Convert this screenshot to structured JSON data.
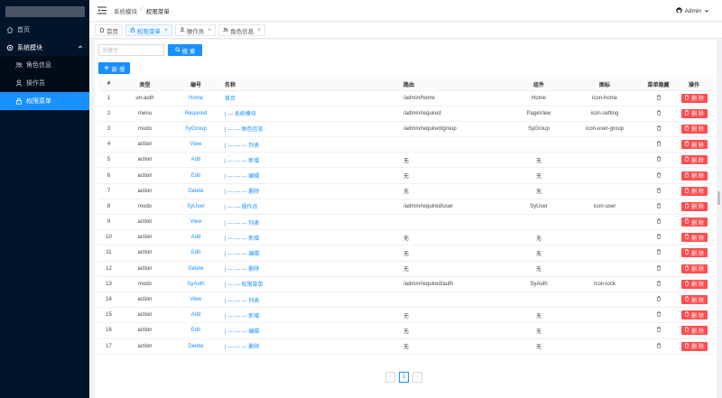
{
  "sidebar": {
    "items": [
      {
        "label": "首页",
        "icon": "home-icon"
      },
      {
        "label": "系统模块",
        "icon": "gear-icon"
      },
      {
        "label": "角色信息",
        "icon": "team-icon"
      },
      {
        "label": "操作员",
        "icon": "user-icon"
      },
      {
        "label": "权限菜单",
        "icon": "lock-icon"
      }
    ]
  },
  "header": {
    "breadcrumb": [
      "系统模块",
      "权限菜单"
    ],
    "separator": "/",
    "user": "Admin"
  },
  "tabs": [
    {
      "label": "首页",
      "icon": "home-icon",
      "closable": false
    },
    {
      "label": "权限菜单",
      "icon": "lock-icon",
      "closable": true
    },
    {
      "label": "操作员",
      "icon": "user-icon",
      "closable": true
    },
    {
      "label": "角色信息",
      "icon": "team-icon",
      "closable": true
    }
  ],
  "tab_close": "×",
  "search": {
    "placeholder": "关键字",
    "button": "搜 索"
  },
  "add_button": "新 增",
  "table": {
    "columns": [
      "#",
      "类型",
      "编号",
      "名称",
      "路由",
      "组件",
      "图标",
      "菜单隐藏",
      "操作"
    ],
    "delete_label": "删 除",
    "rows": [
      {
        "n": "1",
        "type": "un-auth",
        "code": "Home",
        "name": "首页",
        "route": "/admin/home",
        "comp": "Home",
        "icon": "icon-home"
      },
      {
        "n": "2",
        "type": "menu",
        "code": "Required",
        "name": "| --- 系统模块",
        "route": "/admin/required",
        "comp": "PageView",
        "icon": "icon-setting"
      },
      {
        "n": "3",
        "type": "modo",
        "code": "SyGroup",
        "name": "| --- --- 角色信息",
        "route": "/admin/required/group",
        "comp": "SyGroup",
        "icon": "icon-user-group"
      },
      {
        "n": "4",
        "type": "action",
        "code": "View",
        "name": "| --- --- --- 列表",
        "route": "",
        "comp": "",
        "icon": ""
      },
      {
        "n": "5",
        "type": "action",
        "code": "Add",
        "name": "| --- --- --- 新增",
        "route": "无",
        "comp": "无",
        "icon": ""
      },
      {
        "n": "6",
        "type": "action",
        "code": "Edit",
        "name": "| --- --- --- 编辑",
        "route": "无",
        "comp": "无",
        "icon": ""
      },
      {
        "n": "7",
        "type": "action",
        "code": "Delete",
        "name": "| --- --- --- 删除",
        "route": "无",
        "comp": "无",
        "icon": ""
      },
      {
        "n": "8",
        "type": "modo",
        "code": "SyUser",
        "name": "| --- --- 操作员",
        "route": "/admin/required/user",
        "comp": "SyUser",
        "icon": "icon-user"
      },
      {
        "n": "9",
        "type": "action",
        "code": "View",
        "name": "| --- --- --- 列表",
        "route": "",
        "comp": "",
        "icon": ""
      },
      {
        "n": "10",
        "type": "action",
        "code": "Add",
        "name": "| --- --- --- 新增",
        "route": "无",
        "comp": "无",
        "icon": ""
      },
      {
        "n": "11",
        "type": "action",
        "code": "Edit",
        "name": "| --- --- --- 编辑",
        "route": "无",
        "comp": "无",
        "icon": ""
      },
      {
        "n": "12",
        "type": "action",
        "code": "Delete",
        "name": "| --- --- --- 删除",
        "route": "无",
        "comp": "无",
        "icon": ""
      },
      {
        "n": "13",
        "type": "modo",
        "code": "SyAuth",
        "name": "| --- --- 权限菜单",
        "route": "/admin/required/auth",
        "comp": "SyAuth",
        "icon": "icon-lock"
      },
      {
        "n": "14",
        "type": "action",
        "code": "View",
        "name": "| --- --- --- 列表",
        "route": "",
        "comp": "",
        "icon": ""
      },
      {
        "n": "15",
        "type": "action",
        "code": "Add",
        "name": "| --- --- --- 新增",
        "route": "无",
        "comp": "无",
        "icon": ""
      },
      {
        "n": "16",
        "type": "action",
        "code": "Edit",
        "name": "| --- --- --- 编辑",
        "route": "无",
        "comp": "无",
        "icon": ""
      },
      {
        "n": "17",
        "type": "action",
        "code": "Delete",
        "name": "| --- --- --- 删除",
        "route": "无",
        "comp": "无",
        "icon": ""
      }
    ]
  },
  "pagination": {
    "prev": "‹",
    "current": "1",
    "next": "›"
  },
  "colors": {
    "sidebar_bg": "#001529",
    "accent": "#1890ff",
    "danger": "#ff4d4f"
  }
}
